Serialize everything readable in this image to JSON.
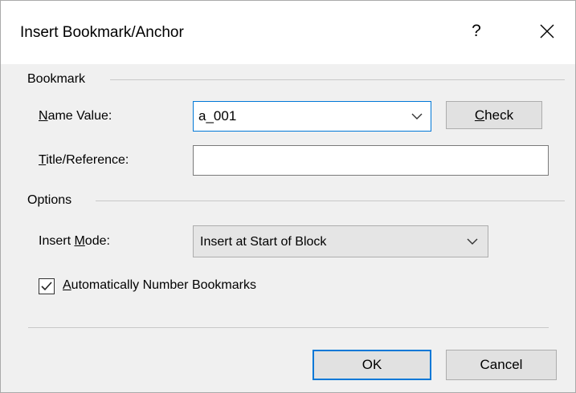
{
  "dialog": {
    "title": "Insert Bookmark/Anchor",
    "help_label": "?"
  },
  "bookmark": {
    "section_label": "Bookmark",
    "name_label_mnemonic": "N",
    "name_label_rest": "ame Value:",
    "name_value": "a_001",
    "check_button_mnemonic": "C",
    "check_button_rest": "heck",
    "title_label_mnemonic": "T",
    "title_label_rest": "itle/Reference:",
    "title_value": ""
  },
  "options": {
    "section_label": "Options",
    "insert_mode_label_prefix": "Insert ",
    "insert_mode_label_mnemonic": "M",
    "insert_mode_label_rest": "ode:",
    "insert_mode_value": "Insert at Start of Block",
    "auto_number_mnemonic": "A",
    "auto_number_rest": "utomatically Number Bookmarks",
    "auto_number_checked": true
  },
  "footer": {
    "ok_label": "OK",
    "cancel_label": "Cancel"
  },
  "icons": {
    "help": "help-icon",
    "close": "close-icon",
    "dropdown": "chevron-down-icon",
    "check": "checkmark-icon"
  },
  "colors": {
    "accent": "#0078d7",
    "dialog_bg": "#f0f0f0",
    "button_bg": "#e1e1e1"
  }
}
